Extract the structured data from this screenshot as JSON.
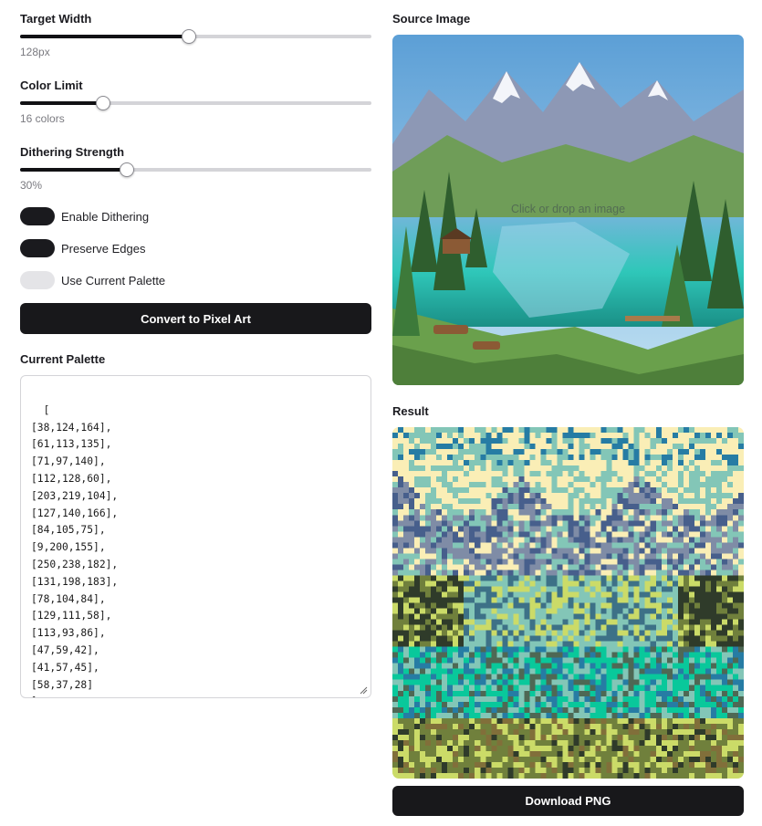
{
  "controls": {
    "target_width": {
      "label": "Target Width",
      "value_text": "128px",
      "fraction": 0.48
    },
    "color_limit": {
      "label": "Color Limit",
      "value_text": "16 colors",
      "fraction": 0.236
    },
    "dithering_strength": {
      "label": "Dithering Strength",
      "value_text": "30%",
      "fraction": 0.305
    }
  },
  "toggles": [
    {
      "label": "Enable Dithering",
      "on": true
    },
    {
      "label": "Preserve Edges",
      "on": true
    },
    {
      "label": "Use Current Palette",
      "on": false
    }
  ],
  "convert_button": "Convert to Pixel Art",
  "palette": {
    "label": "Current Palette",
    "text": "[\n[38,124,164],\n[61,113,135],\n[71,97,140],\n[112,128,60],\n[203,219,104],\n[127,140,166],\n[84,105,75],\n[9,200,155],\n[250,238,182],\n[131,198,183],\n[78,104,84],\n[129,111,58],\n[113,93,86],\n[47,59,42],\n[41,57,45],\n[58,37,28]\n]"
  },
  "source": {
    "label": "Source Image",
    "drop_hint": "Click or drop an image"
  },
  "result": {
    "label": "Result"
  },
  "download_button": "Download PNG",
  "colors": {
    "accent": "#18181b",
    "track": "#d4d4d8",
    "toggle_off": "#e4e4e7"
  }
}
